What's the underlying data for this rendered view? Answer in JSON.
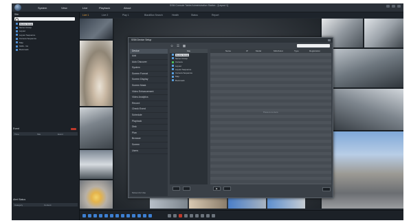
{
  "app": {
    "title": "SSM Console Tablet Administration Station - [Layout 1]",
    "menu": [
      "System",
      "View",
      "Live",
      "Playback",
      "About"
    ]
  },
  "tabs": [
    {
      "label": "Live 1",
      "active": true
    },
    {
      "label": "Live 2",
      "active": false
    },
    {
      "label": "Play 1",
      "active": false
    },
    {
      "label": "BlackBox Search",
      "active": false
    },
    {
      "label": "Health",
      "active": false
    },
    {
      "label": "Status",
      "active": false
    },
    {
      "label": "Report",
      "active": false
    }
  ],
  "sidebar": {
    "title": "Site",
    "search_placeholder": "",
    "tree": [
      {
        "label": "Device Group",
        "selected": true
      },
      {
        "label": "Server Group",
        "selected": false
      },
      {
        "label": "Layout",
        "selected": false
      },
      {
        "label": "Layout Sequence",
        "selected": false
      },
      {
        "label": "Camera Sequence",
        "selected": false
      },
      {
        "label": "Map",
        "selected": false
      },
      {
        "label": "SSM - VA",
        "selected": false
      },
      {
        "label": "Bookmark",
        "selected": false
      }
    ]
  },
  "event_panel": {
    "title": "Event",
    "columns": [
      "Time",
      "Site",
      "Event"
    ]
  },
  "alarm_panel": {
    "title": "Alert Status",
    "columns": [
      "Category",
      "Content"
    ]
  },
  "dialog": {
    "title": "SSM Device Setup",
    "nav_header": "Device",
    "nav_items": [
      {
        "label": "Add",
        "selected": false
      },
      {
        "label": "Auto Discover",
        "selected": false
      },
      {
        "label": "System",
        "selected": false
      },
      {
        "label": "Screen Format",
        "selected": false
      },
      {
        "label": "Screen Display",
        "selected": false
      },
      {
        "label": "Screen Mask",
        "selected": false
      },
      {
        "label": "Video Enhancement",
        "selected": false
      },
      {
        "label": "Video Analytics",
        "selected": false
      },
      {
        "label": "Record",
        "selected": false
      },
      {
        "label": "Check Event",
        "selected": false
      },
      {
        "label": "Schedule",
        "selected": false
      },
      {
        "label": "Playback",
        "selected": false
      },
      {
        "label": "Disk",
        "selected": false
      },
      {
        "label": "Plan",
        "selected": false
      },
      {
        "label": "Browser",
        "selected": false
      },
      {
        "label": "Screen",
        "selected": false
      },
      {
        "label": "Users",
        "selected": false
      }
    ],
    "nav_footer": "Screen for Use",
    "device_tree_header": "Site",
    "device_tree": [
      {
        "label": "Device Group",
        "selected": true,
        "green": false
      },
      {
        "label": "Server Group",
        "selected": false,
        "green": false
      },
      {
        "label": "Camera",
        "selected": false,
        "green": true
      },
      {
        "label": "Layout",
        "selected": false,
        "green": false
      },
      {
        "label": "Layout Sequence",
        "selected": false,
        "green": false
      },
      {
        "label": "Camera Sequence",
        "selected": false,
        "green": false
      },
      {
        "label": "Map",
        "selected": false,
        "green": false
      },
      {
        "label": "Bookmark",
        "selected": false,
        "green": false
      }
    ],
    "grid_columns": [
      "Name",
      "IP",
      "Model",
      "MAC/Host",
      "Type",
      "Registration"
    ],
    "grid_empty_text": "There is no item."
  }
}
